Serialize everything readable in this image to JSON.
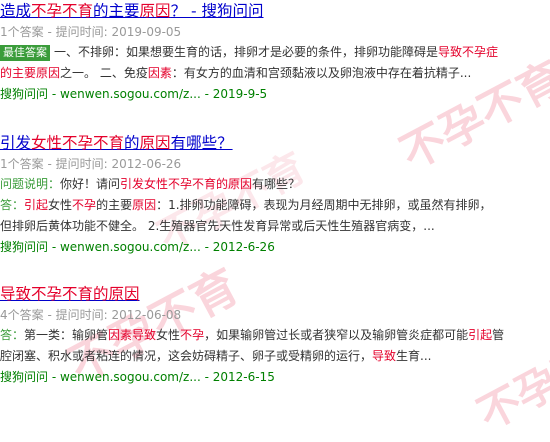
{
  "watermark": "不孕不育",
  "results": [
    {
      "title_pre": "造成",
      "title_hl": "不孕不育",
      "title_mid": "的主要",
      "title_hl2": "原因",
      "title_post": "？ - 搜狗问问",
      "badge": "最佳答案",
      "meta": "1个答案 - 提问时间: 2019-09-05",
      "line1_pre": "一、不排卵：如果想要生育的话，排卵才是必要的条件，排卵功能障碍是",
      "line1_hl": "导致不孕症",
      "line2_hl": "的主要原因",
      "line2_mid": "之一。 二、免疫",
      "line2_hl2": "因素",
      "line2_post": "：有女方的血清和宫颈黏液以及卵泡液中存在着抗精子...",
      "source": "搜狗问问 - wenwen.sogou.com/z... - 2019-9-5"
    },
    {
      "title_pre": "引发",
      "title_hl": "女性不孕不育",
      "title_mid": "的",
      "title_hl2": "原因",
      "title_post": "有哪些？",
      "meta": "1个答案 - 提问时间: 2012-06-26",
      "q_label": "问题说明：",
      "q_pre": "你好！请问",
      "q_hl": "引发女性不孕不育的原因",
      "q_post": "有哪些？",
      "a_label": "答：",
      "a_hl": "引起",
      "a_mid": "女性",
      "a_hl2": "不孕",
      "a_mid2": "的主要",
      "a_hl3": "原因",
      "a_post": "：1.排卵功能障碍，表现为月经周期中无排卵，或虽然有排卵，",
      "a_line2": "但排卵后黄体功能不健全。 2.生殖器官先天性发育异常或后天性生殖器官病变，...",
      "source": "搜狗问问 - wenwen.sogou.com/z... - 2012-6-26"
    },
    {
      "title_hl": "导致不孕不育的原因",
      "meta": "4个答案 - 提问时间: 2012-06-08",
      "a_label": "答：",
      "a_pre": "第一类：输卵管",
      "a_hl": "因素导致",
      "a_mid": "女性",
      "a_hl2": "不孕",
      "a_post": "，如果输卵管过长或者狭窄以及输卵管炎症都可能",
      "a_hl3": "引起",
      "a_end": "管",
      "line2_pre": "腔闭塞、积水或者粘连的情况，这会妨碍精子、卵子或受精卵的运行，",
      "line2_hl": "导致",
      "line2_post": "生育...",
      "source": "搜狗问问 - wenwen.sogou.com/z... - 2012-6-15"
    }
  ]
}
